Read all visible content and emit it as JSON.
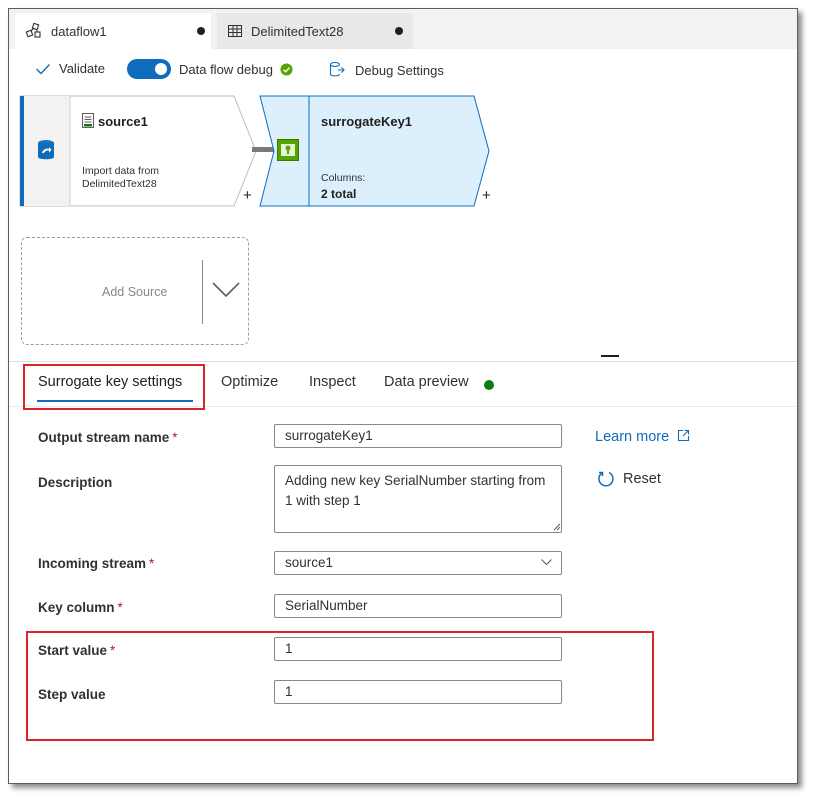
{
  "tabs": [
    {
      "label": "dataflow1",
      "icon": "dataflow-icon"
    },
    {
      "label": "DelimitedText28",
      "icon": "table-icon"
    }
  ],
  "toolbar": {
    "validate_label": "Validate",
    "debug_label": "Data flow debug",
    "debug_settings_label": "Debug Settings"
  },
  "canvas": {
    "source_node": {
      "title": "source1",
      "desc_line1": "Import data from",
      "desc_line2": "DelimitedText28"
    },
    "surrogate_node": {
      "title": "surrogateKey1",
      "columns_label": "Columns:",
      "columns_value": "2 total"
    },
    "add_source_label": "Add Source",
    "plus": "+"
  },
  "settings_tabs": [
    {
      "label": "Surrogate key settings"
    },
    {
      "label": "Optimize"
    },
    {
      "label": "Inspect"
    },
    {
      "label": "Data preview"
    }
  ],
  "form": {
    "output_stream_label": "Output stream name",
    "output_stream_value": "surrogateKey1",
    "description_label": "Description",
    "description_value": "Adding new key SerialNumber starting from 1 with step 1",
    "incoming_stream_label": "Incoming stream",
    "incoming_stream_value": "source1",
    "key_column_label": "Key column",
    "key_column_value": "SerialNumber",
    "start_value_label": "Start value",
    "start_value_value": "1",
    "step_value_label": "Step value",
    "step_value_value": "1",
    "required_mark": "*"
  },
  "links": {
    "learn_more": "Learn more",
    "reset": "Reset"
  },
  "colors": {
    "accent": "#0f6cbd",
    "status_green": "#57a300",
    "highlight_red": "#d6262c",
    "node_selected_bg": "#dceffc"
  }
}
